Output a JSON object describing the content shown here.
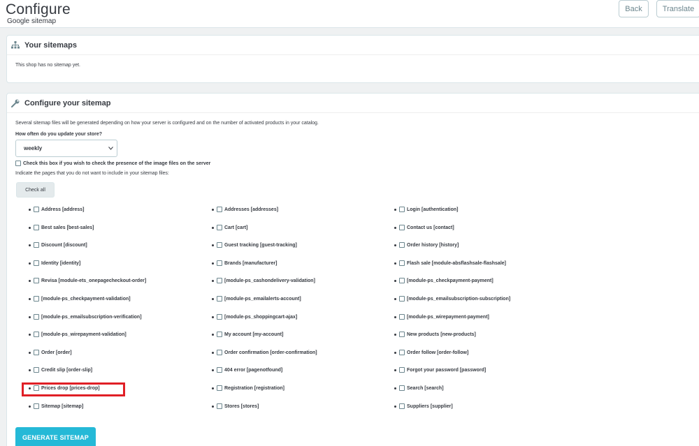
{
  "header": {
    "title": "Configure",
    "subtitle": "Google sitemap",
    "back_label": "Back",
    "translate_label": "Translate"
  },
  "panel_sitemaps": {
    "icon": "sitemap-icon",
    "title": "Your sitemaps",
    "message": "This shop has no sitemap yet."
  },
  "panel_configure": {
    "icon": "wrench-icon",
    "title": "Configure your sitemap",
    "intro": "Several sitemap files will be generated depending on how your server is configured and on the number of activated products in your catalog.",
    "frequency_label": "How often do you update your store?",
    "frequency_value": "weekly",
    "image_check_label": "Check this box if you wish to check the presence of the image files on the server",
    "indicate_text": "Indicate the pages that you do not want to include in your sitemap files:",
    "check_all_label": "Check all",
    "generate_label": "GENERATE SITEMAP"
  },
  "pages": {
    "col1": [
      "Address [address]",
      "Best sales [best-sales]",
      "Discount [discount]",
      "Identity [identity]",
      "Revisa [module-ets_onepagecheckout-order]",
      "[module-ps_checkpayment-validation]",
      "[module-ps_emailsubscription-verification]",
      "[module-ps_wirepayment-validation]",
      "Order [order]",
      "Credit slip [order-slip]",
      "Prices drop [prices-drop]",
      "Sitemap [sitemap]"
    ],
    "col2": [
      "Addresses [addresses]",
      "Cart [cart]",
      "Guest tracking [guest-tracking]",
      "Brands [manufacturer]",
      "[module-ps_cashondelivery-validation]",
      "[module-ps_emailalerts-account]",
      "[module-ps_shoppingcart-ajax]",
      "My account [my-account]",
      "Order confirmation [order-confirmation]",
      "404 error [pagenotfound]",
      "Registration [registration]",
      "Stores [stores]"
    ],
    "col3": [
      "Login [authentication]",
      "Contact us [contact]",
      "Order history [history]",
      "Flash sale [module-absflashsale-flashsale]",
      "[module-ps_checkpayment-payment]",
      "[module-ps_emailsubscription-subscription]",
      "[module-ps_wirepayment-payment]",
      "New products [new-products]",
      "Order follow [order-follow]",
      "Forgot your password [password]",
      "Search [search]",
      "Suppliers [supplier]"
    ]
  },
  "colors": {
    "accent": "#25b9d7",
    "highlight": "#e01f26"
  }
}
